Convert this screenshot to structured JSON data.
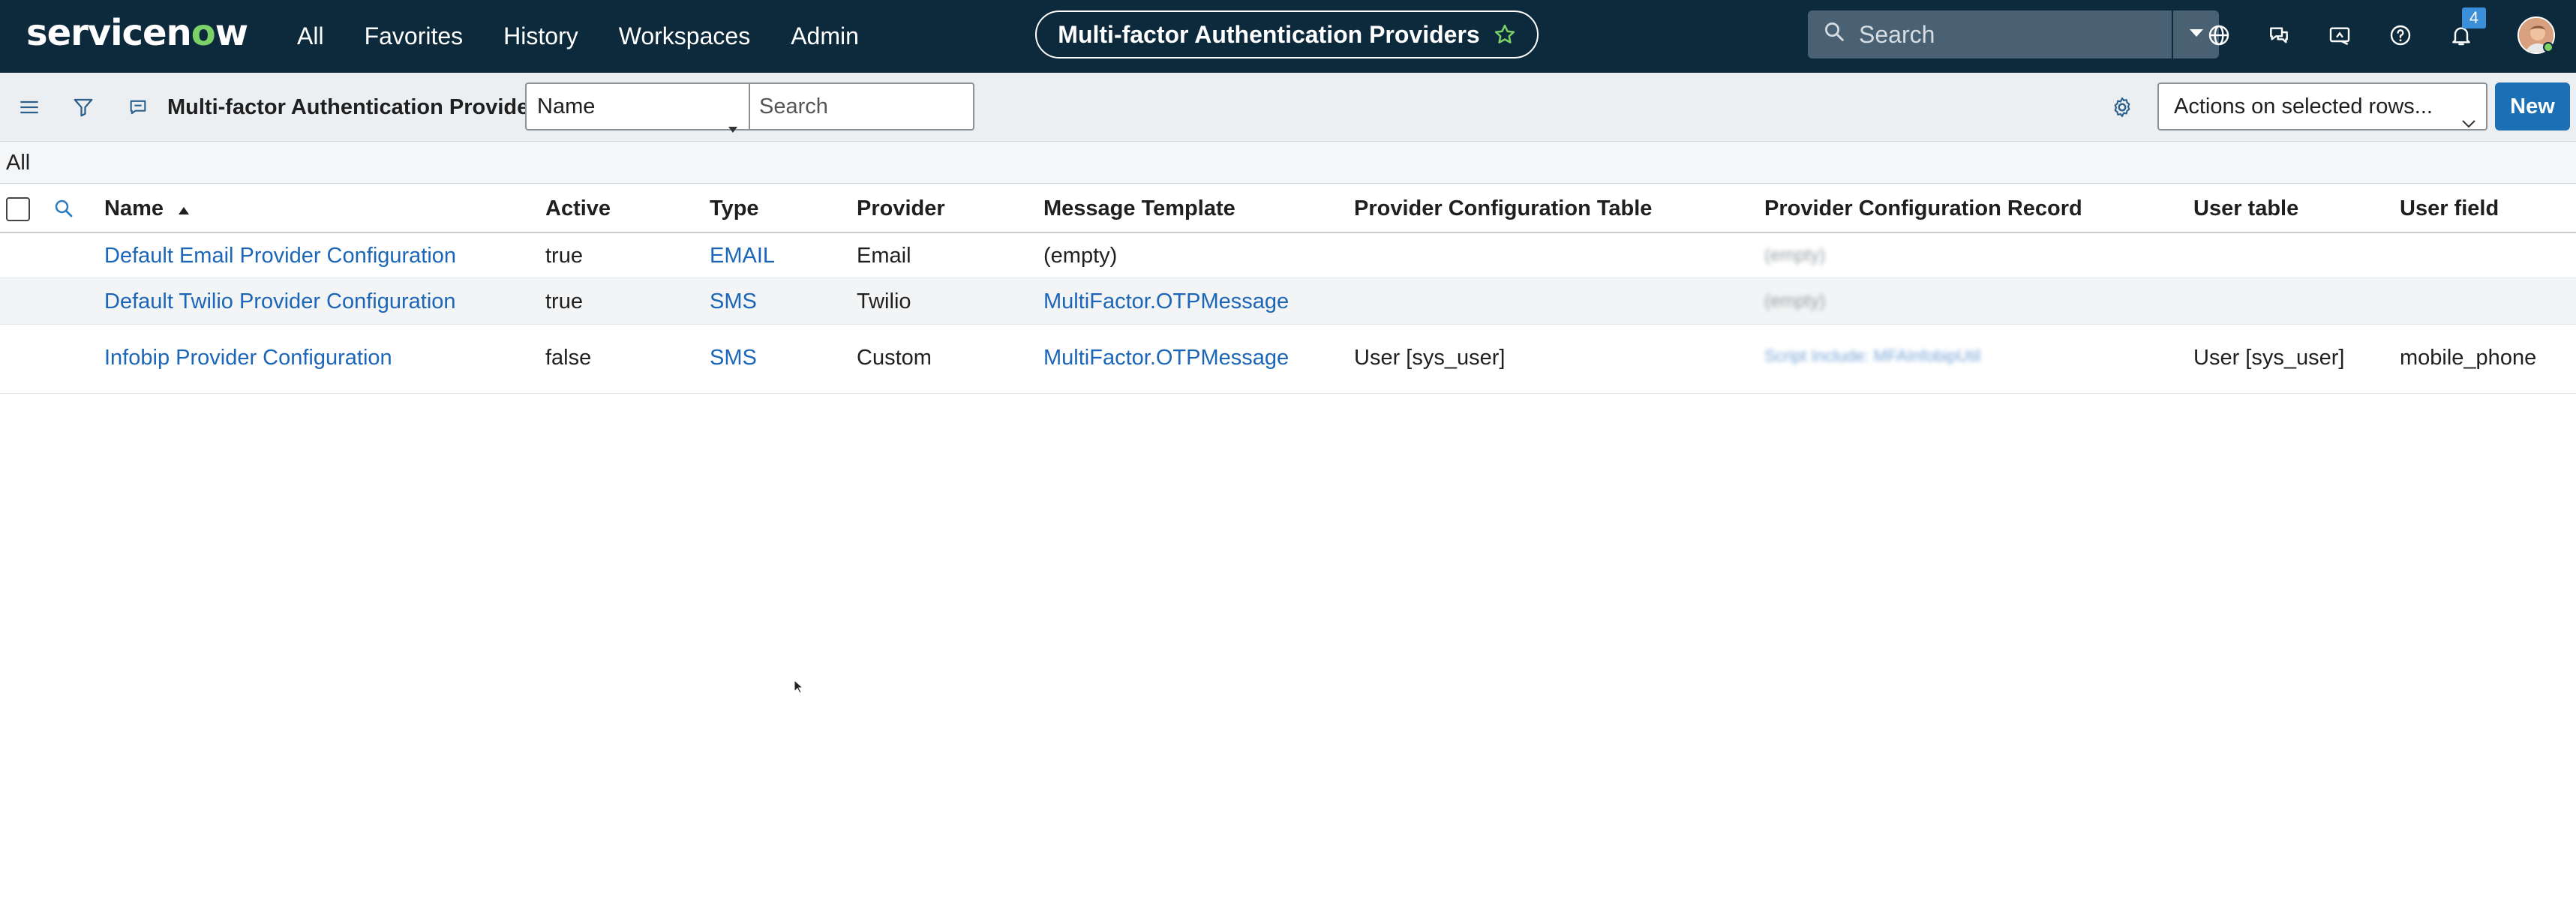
{
  "topnav": {
    "logo_pre": "servicen",
    "logo_o": "o",
    "logo_post": "w",
    "menu": [
      "All",
      "Favorites",
      "History",
      "Workspaces",
      "Admin"
    ],
    "page_title": "Multi-factor Authentication Providers",
    "search_placeholder": "Search",
    "notification_count": "4"
  },
  "toolbar": {
    "list_title": "Multi-factor Authentication Providers",
    "field_select_value": "Name",
    "search_placeholder": "Search",
    "actions_value": "Actions on selected rows...",
    "new_label": "New"
  },
  "breadcrumb": "All",
  "table": {
    "columns": [
      "Name",
      "Active",
      "Type",
      "Provider",
      "Message Template",
      "Provider Configuration Table",
      "Provider Configuration Record",
      "User table",
      "User field"
    ],
    "rows": [
      {
        "name": "Default Email Provider Configuration",
        "active": "true",
        "type": "EMAIL",
        "provider": "Email",
        "message_template": "(empty)",
        "config_table": "",
        "config_record": "(empty)",
        "user_table": "",
        "user_field": ""
      },
      {
        "name": "Default Twilio Provider Configuration",
        "active": "true",
        "type": "SMS",
        "provider": "Twilio",
        "message_template": "MultiFactor.OTPMessage",
        "config_table": "",
        "config_record": "(empty)",
        "user_table": "",
        "user_field": ""
      },
      {
        "name": "Infobip Provider Configuration",
        "active": "false",
        "type": "SMS",
        "provider": "Custom",
        "message_template": "MultiFactor.OTPMessage",
        "config_table": "User [sys_user]",
        "config_record": "Script Include: MFAInfobipUtil",
        "user_table": "User [sys_user]",
        "user_field": "mobile_phone"
      }
    ]
  },
  "colors": {
    "nav_bg": "#0d2a3c",
    "accent_green": "#7cd167",
    "link_blue": "#1b66b8",
    "primary_button": "#1b6fb5"
  }
}
